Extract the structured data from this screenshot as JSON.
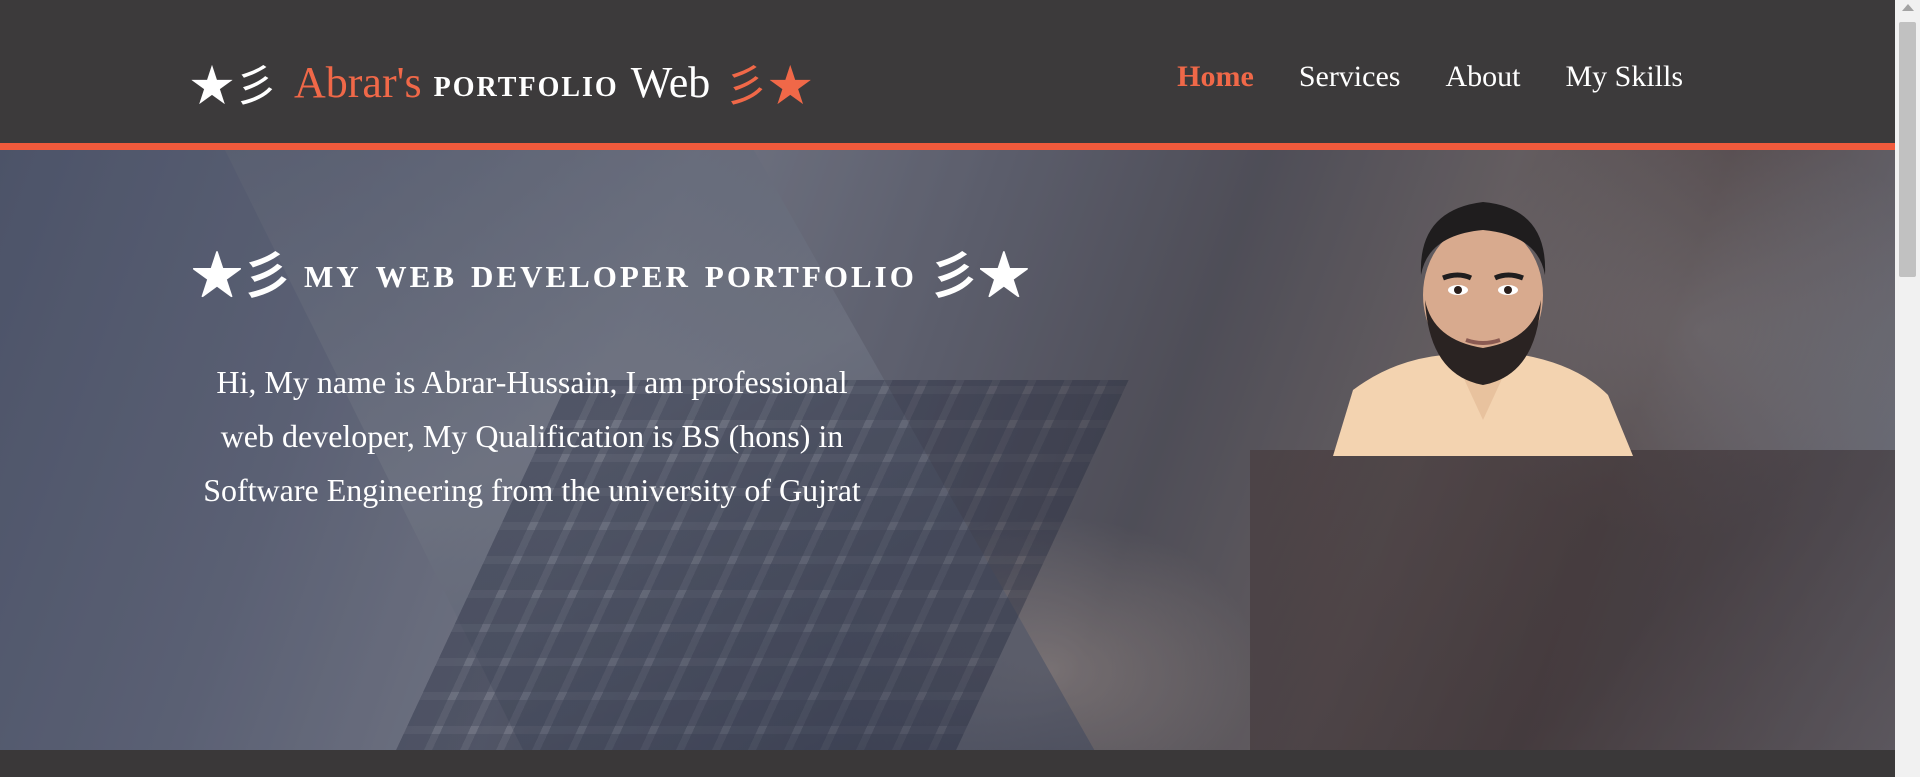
{
  "brand": {
    "symbol_left": "★彡",
    "name": "Abrar's",
    "portfolio": "PORTFOLIO",
    "web": "Web",
    "symbol_right": "彡★"
  },
  "nav": {
    "items": [
      {
        "label": "Home",
        "active": true
      },
      {
        "label": "Services",
        "active": false
      },
      {
        "label": "About",
        "active": false
      },
      {
        "label": "My Skills",
        "active": false
      }
    ]
  },
  "hero": {
    "title_symbol_left": "★彡",
    "title": "MY WEB DEVELOPER PORTFOLIO",
    "title_symbol_right": "彡★",
    "intro": "Hi, My name is Abrar-Hussain, I am professional web developer, My Qualification is BS (hons) in Software Engineering from the university of Gujrat"
  },
  "colors": {
    "accent": "#f06848",
    "header_bg": "#3c3a3b",
    "accent_line": "#f05a3c"
  }
}
